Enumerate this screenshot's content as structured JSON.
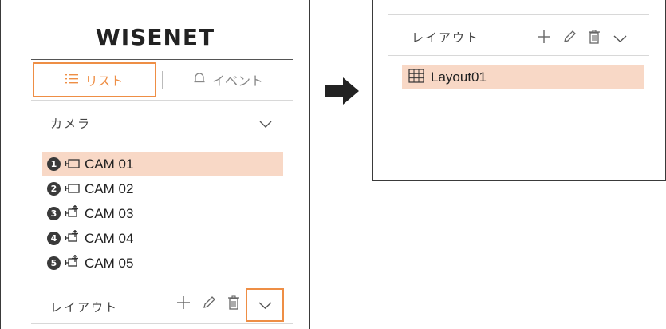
{
  "left": {
    "logo": "WISENET",
    "tabs": [
      {
        "label": "リスト",
        "icon": "list-icon",
        "selected": true
      },
      {
        "label": "イベント",
        "icon": "bell-icon",
        "selected": false
      }
    ],
    "camera_section": {
      "title": "カメラ",
      "icon": "chevron-down-icon"
    },
    "cameras": [
      {
        "num": "1",
        "label": "CAM 01",
        "icon": "camera-box-icon",
        "selected": true
      },
      {
        "num": "2",
        "label": "CAM 02",
        "icon": "camera-box-icon",
        "selected": false
      },
      {
        "num": "3",
        "label": "CAM 03",
        "icon": "ptz-camera-icon",
        "selected": false
      },
      {
        "num": "4",
        "label": "CAM 04",
        "icon": "ptz-camera-icon",
        "selected": false
      },
      {
        "num": "5",
        "label": "CAM 05",
        "icon": "ptz-camera-icon",
        "selected": false
      }
    ],
    "layout_section": {
      "title": "レイアウト"
    }
  },
  "right": {
    "layout_section": {
      "title": "レイアウト"
    },
    "layouts": [
      {
        "label": "Layout01",
        "icon": "grid-icon",
        "selected": true
      }
    ]
  },
  "colors": {
    "accent": "#ee8e45",
    "selection": "#f8d8c6",
    "badge": "#3a3a3a"
  }
}
